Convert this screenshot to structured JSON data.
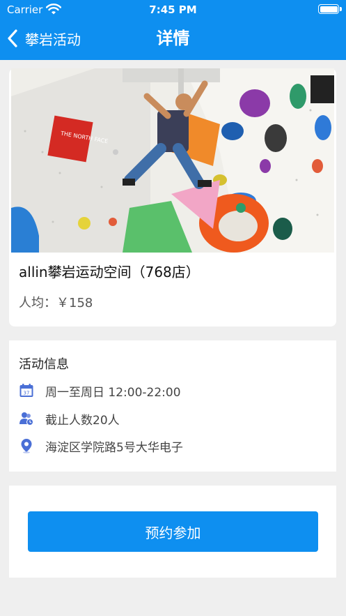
{
  "status_bar": {
    "carrier": "Carrier",
    "time": "7:45 PM"
  },
  "nav": {
    "back_label": "攀岩活动",
    "title": "详情"
  },
  "venue": {
    "photo_sign_text": "THE NORTH FACE",
    "name": "allin攀岩运动空间（768店）",
    "avg_price": "人均：￥158"
  },
  "info": {
    "title": "活动信息",
    "rows": [
      {
        "icon": "calendar-icon",
        "icon_text": "37",
        "text": "周一至周日 12:00-22:00"
      },
      {
        "icon": "people-icon",
        "text": "截止人数20人"
      },
      {
        "icon": "location-pin-icon",
        "text": "海淀区学院路5号大华电子"
      }
    ]
  },
  "action": {
    "join_label": "预约参加"
  },
  "colors": {
    "primary": "#0e8ff0",
    "icon": "#4a6fd6",
    "background": "#efefef"
  }
}
